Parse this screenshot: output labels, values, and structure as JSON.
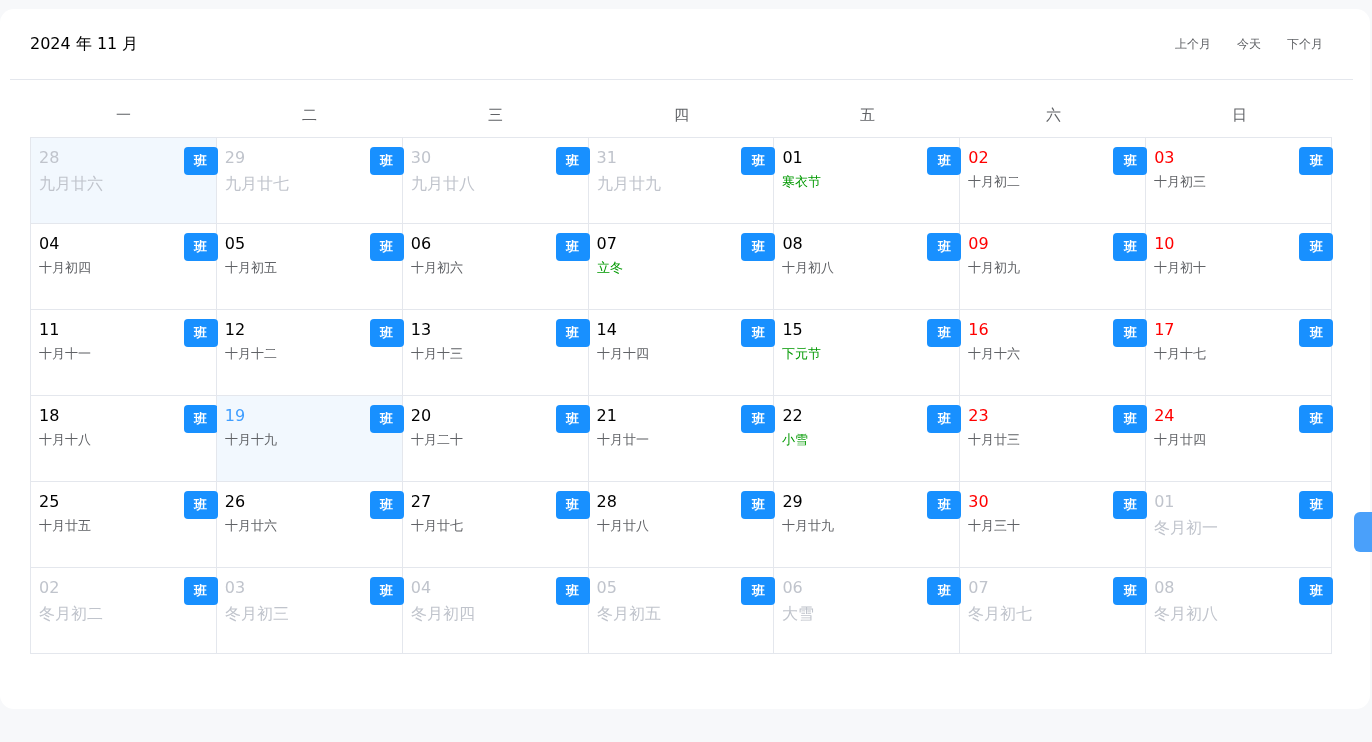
{
  "header": {
    "title": "2024 年 11 月",
    "buttons": [
      "上个月",
      "今天",
      "下个月"
    ]
  },
  "weekdays": [
    "一",
    "二",
    "三",
    "四",
    "五",
    "六",
    "日"
  ],
  "cells": [
    {
      "day": "28",
      "lunar": "九月廿六",
      "kind": "adjacent",
      "today": false,
      "selected": true,
      "badge": "班"
    },
    {
      "day": "29",
      "lunar": "九月廿七",
      "kind": "adjacent",
      "today": false,
      "selected": false,
      "badge": "班"
    },
    {
      "day": "30",
      "lunar": "九月廿八",
      "kind": "adjacent",
      "today": false,
      "selected": false,
      "badge": "班"
    },
    {
      "day": "31",
      "lunar": "九月廿九",
      "kind": "adjacent",
      "today": false,
      "selected": false,
      "badge": "班"
    },
    {
      "day": "01",
      "lunar": "寒衣节",
      "kind": "current",
      "festival": true,
      "today": false,
      "selected": false,
      "badge": "班"
    },
    {
      "day": "02",
      "lunar": "十月初二",
      "kind": "weekend",
      "festival": false,
      "today": false,
      "selected": false,
      "badge": "班"
    },
    {
      "day": "03",
      "lunar": "十月初三",
      "kind": "weekend",
      "festival": false,
      "today": false,
      "selected": false,
      "badge": "班"
    },
    {
      "day": "04",
      "lunar": "十月初四",
      "kind": "current",
      "festival": false,
      "today": false,
      "selected": false,
      "badge": "班"
    },
    {
      "day": "05",
      "lunar": "十月初五",
      "kind": "current",
      "festival": false,
      "today": false,
      "selected": false,
      "badge": "班"
    },
    {
      "day": "06",
      "lunar": "十月初六",
      "kind": "current",
      "festival": false,
      "today": false,
      "selected": false,
      "badge": "班"
    },
    {
      "day": "07",
      "lunar": "立冬",
      "kind": "current",
      "festival": true,
      "today": false,
      "selected": false,
      "badge": "班"
    },
    {
      "day": "08",
      "lunar": "十月初八",
      "kind": "current",
      "festival": false,
      "today": false,
      "selected": false,
      "badge": "班"
    },
    {
      "day": "09",
      "lunar": "十月初九",
      "kind": "weekend",
      "festival": false,
      "today": false,
      "selected": false,
      "badge": "班"
    },
    {
      "day": "10",
      "lunar": "十月初十",
      "kind": "weekend",
      "festival": false,
      "today": false,
      "selected": false,
      "badge": "班"
    },
    {
      "day": "11",
      "lunar": "十月十一",
      "kind": "current",
      "festival": false,
      "today": false,
      "selected": false,
      "badge": "班"
    },
    {
      "day": "12",
      "lunar": "十月十二",
      "kind": "current",
      "festival": false,
      "today": false,
      "selected": false,
      "badge": "班"
    },
    {
      "day": "13",
      "lunar": "十月十三",
      "kind": "current",
      "festival": false,
      "today": false,
      "selected": false,
      "badge": "班"
    },
    {
      "day": "14",
      "lunar": "十月十四",
      "kind": "current",
      "festival": false,
      "today": false,
      "selected": false,
      "badge": "班"
    },
    {
      "day": "15",
      "lunar": "下元节",
      "kind": "current",
      "festival": true,
      "today": false,
      "selected": false,
      "badge": "班"
    },
    {
      "day": "16",
      "lunar": "十月十六",
      "kind": "weekend",
      "festival": false,
      "today": false,
      "selected": false,
      "badge": "班"
    },
    {
      "day": "17",
      "lunar": "十月十七",
      "kind": "weekend",
      "festival": false,
      "today": false,
      "selected": false,
      "badge": "班"
    },
    {
      "day": "18",
      "lunar": "十月十八",
      "kind": "current",
      "festival": false,
      "today": false,
      "selected": false,
      "badge": "班"
    },
    {
      "day": "19",
      "lunar": "十月十九",
      "kind": "current",
      "festival": false,
      "today": true,
      "selected": true,
      "badge": "班"
    },
    {
      "day": "20",
      "lunar": "十月二十",
      "kind": "current",
      "festival": false,
      "today": false,
      "selected": false,
      "badge": "班"
    },
    {
      "day": "21",
      "lunar": "十月廿一",
      "kind": "current",
      "festival": false,
      "today": false,
      "selected": false,
      "badge": "班"
    },
    {
      "day": "22",
      "lunar": "小雪",
      "kind": "current",
      "festival": true,
      "today": false,
      "selected": false,
      "badge": "班"
    },
    {
      "day": "23",
      "lunar": "十月廿三",
      "kind": "weekend",
      "festival": false,
      "today": false,
      "selected": false,
      "badge": "班"
    },
    {
      "day": "24",
      "lunar": "十月廿四",
      "kind": "weekend",
      "festival": false,
      "today": false,
      "selected": false,
      "badge": "班"
    },
    {
      "day": "25",
      "lunar": "十月廿五",
      "kind": "current",
      "festival": false,
      "today": false,
      "selected": false,
      "badge": "班"
    },
    {
      "day": "26",
      "lunar": "十月廿六",
      "kind": "current",
      "festival": false,
      "today": false,
      "selected": false,
      "badge": "班"
    },
    {
      "day": "27",
      "lunar": "十月廿七",
      "kind": "current",
      "festival": false,
      "today": false,
      "selected": false,
      "badge": "班"
    },
    {
      "day": "28",
      "lunar": "十月廿八",
      "kind": "current",
      "festival": false,
      "today": false,
      "selected": false,
      "badge": "班"
    },
    {
      "day": "29",
      "lunar": "十月廿九",
      "kind": "current",
      "festival": false,
      "today": false,
      "selected": false,
      "badge": "班"
    },
    {
      "day": "30",
      "lunar": "十月三十",
      "kind": "weekend",
      "festival": false,
      "today": false,
      "selected": false,
      "badge": "班"
    },
    {
      "day": "01",
      "lunar": "冬月初一",
      "kind": "adjacent",
      "today": false,
      "selected": false,
      "badge": "班"
    },
    {
      "day": "02",
      "lunar": "冬月初二",
      "kind": "adjacent",
      "today": false,
      "selected": false,
      "badge": "班"
    },
    {
      "day": "03",
      "lunar": "冬月初三",
      "kind": "adjacent",
      "today": false,
      "selected": false,
      "badge": "班"
    },
    {
      "day": "04",
      "lunar": "冬月初四",
      "kind": "adjacent",
      "today": false,
      "selected": false,
      "badge": "班"
    },
    {
      "day": "05",
      "lunar": "冬月初五",
      "kind": "adjacent",
      "today": false,
      "selected": false,
      "badge": "班"
    },
    {
      "day": "06",
      "lunar": "大雪",
      "kind": "adjacent",
      "today": false,
      "selected": false,
      "badge": "班"
    },
    {
      "day": "07",
      "lunar": "冬月初七",
      "kind": "adjacent",
      "today": false,
      "selected": false,
      "badge": "班"
    },
    {
      "day": "08",
      "lunar": "冬月初八",
      "kind": "adjacent",
      "today": false,
      "selected": false,
      "badge": "班"
    }
  ]
}
